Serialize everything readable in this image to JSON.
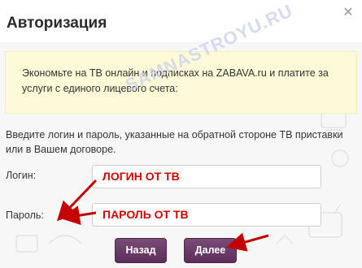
{
  "dialog": {
    "title": "Авторизация",
    "close_icon": "close-icon"
  },
  "notice": {
    "text": "Экономьте на ТВ онлайн и подписках на ZABAVA.ru и платите за услуги с единого лицевого счета:"
  },
  "instructions": "Введите логин и пароль, указанные на обратной стороне ТВ приставки или в Вашем договоре.",
  "form": {
    "login_label": "Логин:",
    "login_value": "ЛОГИН ОТ ТВ",
    "password_label": "Пароль:",
    "password_value": "ПАРОЛЬ ОТ ТВ"
  },
  "buttons": {
    "back": "Назад",
    "next": "Далее"
  },
  "watermark": "SAMNASTROYU.RU",
  "colors": {
    "button": "#6a3d68",
    "annotation": "#c40000",
    "notice_bg": "#fdfbd7"
  }
}
